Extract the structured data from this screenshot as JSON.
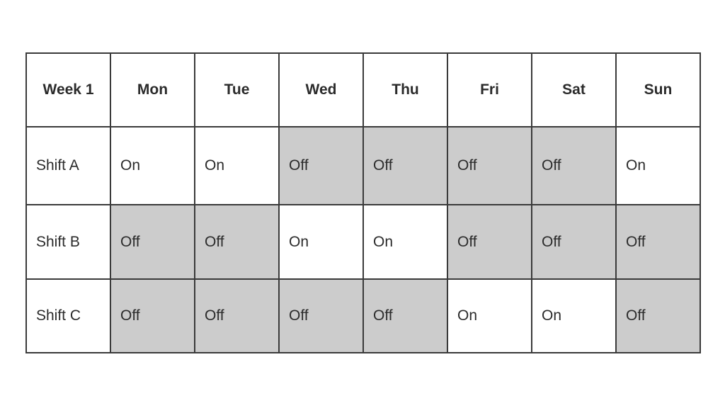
{
  "table": {
    "caption_label": "Week 1",
    "columns": [
      {
        "key": "label",
        "header": "Week 1"
      },
      {
        "key": "mon",
        "header": "Mon"
      },
      {
        "key": "tue",
        "header": "Tue"
      },
      {
        "key": "wed",
        "header": "Wed"
      },
      {
        "key": "thu",
        "header": "Thu"
      },
      {
        "key": "fri",
        "header": "Fri"
      },
      {
        "key": "sat",
        "header": "Sat"
      },
      {
        "key": "sun",
        "header": "Sun"
      }
    ],
    "rows": [
      {
        "label": "Shift A",
        "cells": [
          {
            "value": "On",
            "state": "on"
          },
          {
            "value": "On",
            "state": "on"
          },
          {
            "value": "Off",
            "state": "off"
          },
          {
            "value": "Off",
            "state": "off"
          },
          {
            "value": "Off",
            "state": "off"
          },
          {
            "value": "Off",
            "state": "off"
          },
          {
            "value": "On",
            "state": "on"
          }
        ]
      },
      {
        "label": "Shift B",
        "cells": [
          {
            "value": "Off",
            "state": "off"
          },
          {
            "value": "Off",
            "state": "off"
          },
          {
            "value": "On",
            "state": "on"
          },
          {
            "value": "On",
            "state": "on"
          },
          {
            "value": "Off",
            "state": "off"
          },
          {
            "value": "Off",
            "state": "off"
          },
          {
            "value": "Off",
            "state": "off"
          }
        ]
      },
      {
        "label": "Shift C",
        "cells": [
          {
            "value": "Off",
            "state": "off"
          },
          {
            "value": "Off",
            "state": "off"
          },
          {
            "value": "Off",
            "state": "off"
          },
          {
            "value": "Off",
            "state": "off"
          },
          {
            "value": "On",
            "state": "on"
          },
          {
            "value": "On",
            "state": "on"
          },
          {
            "value": "Off",
            "state": "off"
          }
        ]
      }
    ]
  },
  "colors": {
    "off_fill": "#cccccc",
    "on_fill": "#ffffff",
    "border": "#3a3a3a",
    "text": "#2b2b2b",
    "page_background": "#ffffff"
  }
}
